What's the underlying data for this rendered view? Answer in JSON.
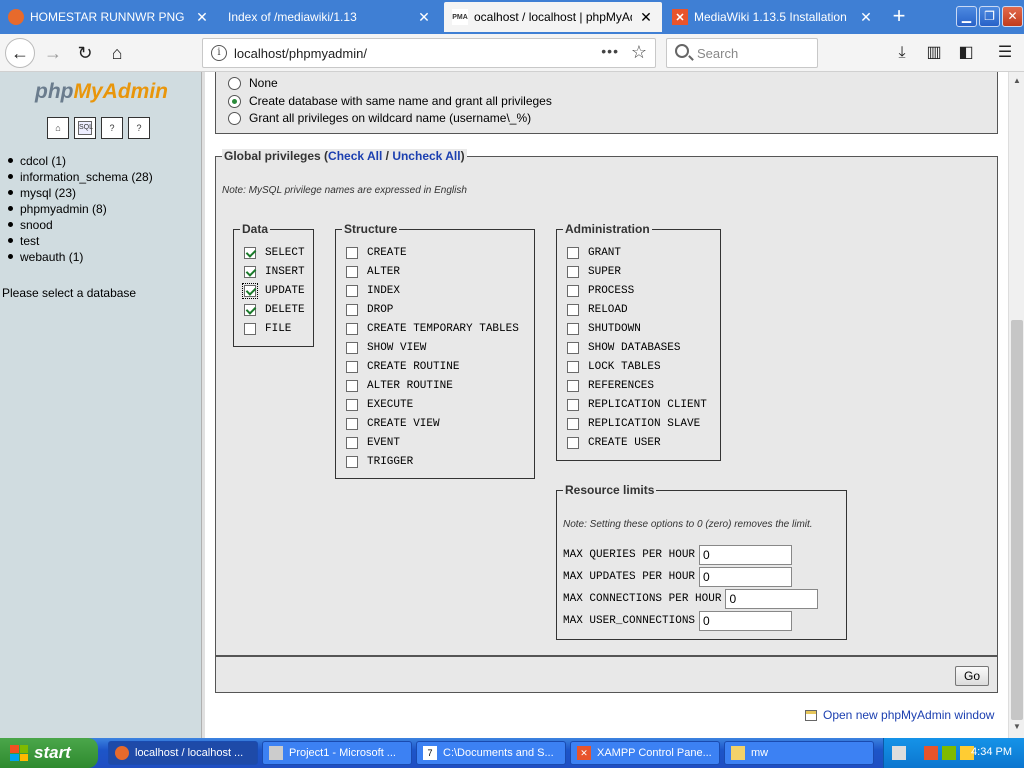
{
  "browser": {
    "tabs": [
      {
        "title": "HOMESTAR RUNNWR PNG at Dur",
        "active": false
      },
      {
        "title": "Index of /mediawiki/1.13",
        "active": false
      },
      {
        "title": "ocalhost / localhost | phpMyAdmin",
        "active": true
      },
      {
        "title": "MediaWiki 1.13.5 Installation",
        "active": false
      }
    ],
    "tab_favicon_pma": "PMA",
    "url": "localhost/phpmyadmin/",
    "search_placeholder": "Search",
    "accent": "#3f7fd4"
  },
  "sidebar": {
    "logo_part1": "php",
    "logo_part2": "MyAdmin",
    "icon_sql": "SQL",
    "databases": [
      "cdcol (1)",
      "information_schema (28)",
      "mysql (23)",
      "phpmyadmin (8)",
      "snood",
      "test",
      "webauth (1)"
    ],
    "select_db_text": "Please select a database"
  },
  "database_options": [
    {
      "label": "None",
      "checked": false
    },
    {
      "label": "Create database with same name and grant all privileges",
      "checked": true
    },
    {
      "label": "Grant all privileges on wildcard name (username\\_%)",
      "checked": false
    }
  ],
  "global_privileges": {
    "legend": "Global privileges",
    "paren_open": "(",
    "check_all": "Check All",
    "separator": " / ",
    "uncheck_all": "Uncheck All",
    "paren_close": ")",
    "note": "Note: MySQL privilege names are expressed in English",
    "data": {
      "legend": "Data",
      "items": [
        {
          "label": "SELECT",
          "checked": true
        },
        {
          "label": "INSERT",
          "checked": true
        },
        {
          "label": "UPDATE",
          "checked": true
        },
        {
          "label": "DELETE",
          "checked": true
        },
        {
          "label": "FILE",
          "checked": false
        }
      ]
    },
    "structure": {
      "legend": "Structure",
      "items": [
        {
          "label": "CREATE",
          "checked": false
        },
        {
          "label": "ALTER",
          "checked": false
        },
        {
          "label": "INDEX",
          "checked": false
        },
        {
          "label": "DROP",
          "checked": false
        },
        {
          "label": "CREATE TEMPORARY TABLES",
          "checked": false
        },
        {
          "label": "SHOW VIEW",
          "checked": false
        },
        {
          "label": "CREATE ROUTINE",
          "checked": false
        },
        {
          "label": "ALTER ROUTINE",
          "checked": false
        },
        {
          "label": "EXECUTE",
          "checked": false
        },
        {
          "label": "CREATE VIEW",
          "checked": false
        },
        {
          "label": "EVENT",
          "checked": false
        },
        {
          "label": "TRIGGER",
          "checked": false
        }
      ]
    },
    "administration": {
      "legend": "Administration",
      "items": [
        {
          "label": "GRANT",
          "checked": false
        },
        {
          "label": "SUPER",
          "checked": false
        },
        {
          "label": "PROCESS",
          "checked": false
        },
        {
          "label": "RELOAD",
          "checked": false
        },
        {
          "label": "SHUTDOWN",
          "checked": false
        },
        {
          "label": "SHOW DATABASES",
          "checked": false
        },
        {
          "label": "LOCK TABLES",
          "checked": false
        },
        {
          "label": "REFERENCES",
          "checked": false
        },
        {
          "label": "REPLICATION CLIENT",
          "checked": false
        },
        {
          "label": "REPLICATION SLAVE",
          "checked": false
        },
        {
          "label": "CREATE USER",
          "checked": false
        }
      ]
    },
    "resource_limits": {
      "legend": "Resource limits",
      "note": "Note: Setting these options to 0 (zero) removes the limit.",
      "items": [
        {
          "label": "MAX QUERIES PER HOUR",
          "value": "0"
        },
        {
          "label": "MAX UPDATES PER HOUR",
          "value": "0"
        },
        {
          "label": "MAX CONNECTIONS PER HOUR",
          "value": "0"
        },
        {
          "label": "MAX USER_CONNECTIONS",
          "value": "0"
        }
      ]
    }
  },
  "go_button": "Go",
  "open_new_window": "Open new phpMyAdmin window",
  "taskbar": {
    "start_label": "start",
    "buttons": [
      {
        "label": "localhost / localhost ...",
        "active": true
      },
      {
        "label": "Project1 - Microsoft ...",
        "active": false
      },
      {
        "label": "C:\\Documents and S...",
        "active": false
      },
      {
        "label": "XAMPP Control Pane...",
        "active": false
      },
      {
        "label": "mw",
        "active": false
      }
    ],
    "clock": "4:34 PM"
  }
}
